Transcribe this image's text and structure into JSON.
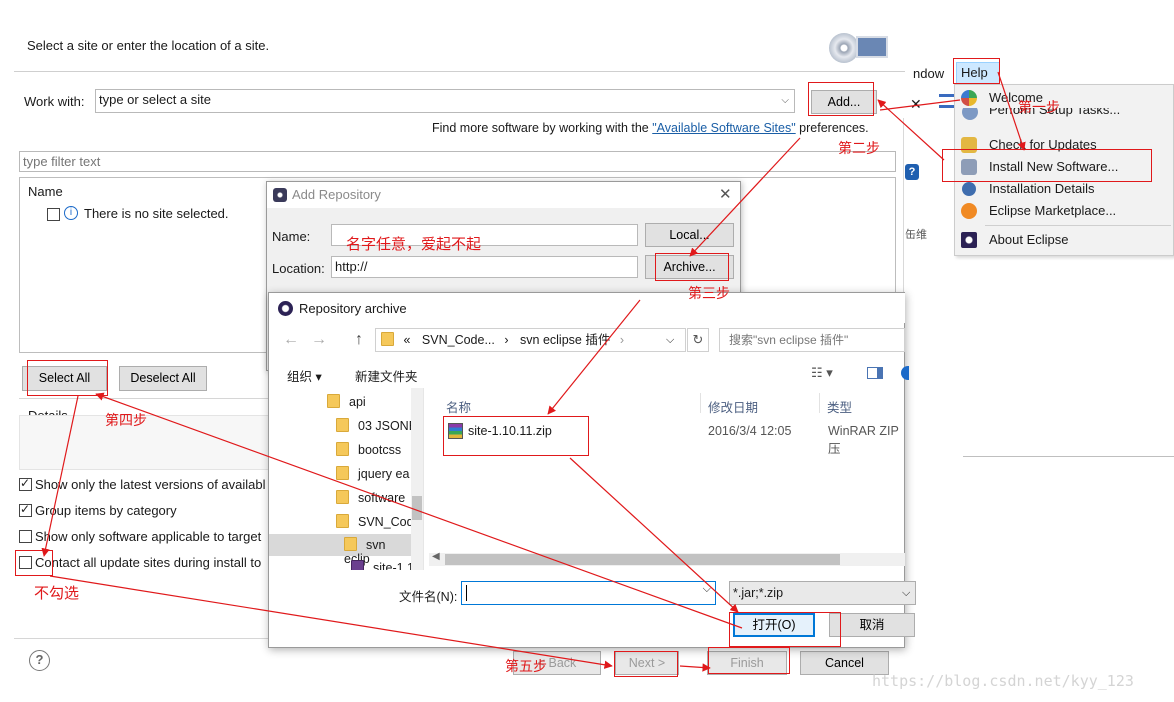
{
  "wizard": {
    "subtitle": "Select a site or enter the location of a site.",
    "work_with_label": "Work with:",
    "work_with_value": "type or select a site",
    "add_button": "Add...",
    "find_more_prefix": "Find more software by working with the ",
    "find_more_link": "\"Available Software Sites\"",
    "find_more_suffix": " preferences.",
    "filter_placeholder": "type filter text",
    "name_header": "Name",
    "no_site": "There is no site selected.",
    "select_all": "Select All",
    "deselect_all": "Deselect All",
    "details_label": "Details",
    "options": [
      {
        "label": "Show only the latest versions of availabl",
        "checked": true
      },
      {
        "label": "Group items by category",
        "checked": true
      },
      {
        "label": "Show only software applicable to target",
        "checked": false
      },
      {
        "label": "Contact all update sites during install to",
        "checked": false
      }
    ],
    "back_button": "< Back",
    "next_button": "Next >",
    "finish_button": "Finish",
    "cancel_button": "Cancel",
    "help_glyph": "?"
  },
  "help_menu": {
    "window_menu": "ndow",
    "help_menu": "Help",
    "items": [
      {
        "label": "Welcome",
        "icon": "welcome-icon"
      },
      {
        "label": "Perform Setup Tasks...",
        "icon": "setup-icon"
      },
      {
        "label": "Check for Updates",
        "icon": "update-icon"
      },
      {
        "label": "Install New Software...",
        "icon": "install-icon"
      },
      {
        "label": "Installation Details",
        "icon": "details-icon"
      },
      {
        "label": "Eclipse Marketplace...",
        "icon": "marketplace-icon"
      },
      {
        "label": "About Eclipse",
        "icon": "eclipse-icon"
      }
    ],
    "side_glyph": "?",
    "side_text": "缶维"
  },
  "add_repository": {
    "title": "Add Repository",
    "name_label": "Name:",
    "name_value": "",
    "location_label": "Location:",
    "location_value": "http://",
    "local_button": "Local...",
    "archive_button": "Archive..."
  },
  "repository_archive": {
    "title": "Repository archive",
    "breadcrumb": [
      "«",
      "SVN_Code...",
      "svn eclipse 插件"
    ],
    "search_placeholder": "搜索\"svn eclipse 插件\"",
    "organize": "组织 ▾",
    "new_folder": "新建文件夹",
    "tree": [
      "api",
      "03 JSONE",
      "bootcss",
      "jquery ea",
      "software",
      "SVN_Cod",
      "svn eclip",
      "site-1.1"
    ],
    "columns": [
      "名称",
      "修改日期",
      "类型"
    ],
    "file": {
      "name": "site-1.10.11.zip",
      "date": "2016/3/4 12:05",
      "type": "WinRAR ZIP 压"
    },
    "filename_label": "文件名(N):",
    "filename_value": "",
    "filter_value": "*.jar;*.zip",
    "open_button": "打开(O)",
    "cancel_button": "取消"
  },
  "annotations": {
    "step1": "第一步",
    "step2": "第二步",
    "step3": "第三步",
    "step4": "第四步",
    "step5": "第五步",
    "name_note": "名字任意，爱起不起",
    "no_check": "不勾选"
  },
  "watermark": "https://blog.csdn.net/kyy_123",
  "colors": {
    "annotation_red": "#e0191b",
    "link_blue": "#1a5ea6",
    "selection_blue": "#cde8ff"
  }
}
